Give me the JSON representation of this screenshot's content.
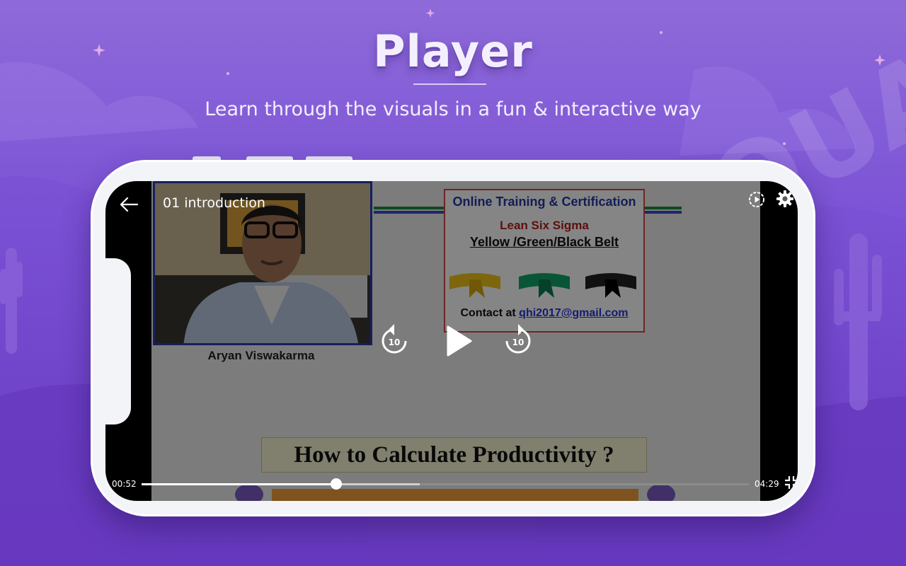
{
  "promo": {
    "headline": "Player",
    "tagline": "Learn through the visuals in a fun & interactive way",
    "watermark": "QUAL"
  },
  "player": {
    "video_title": "01 introduction",
    "time_current": "00:52",
    "time_total": "04:29",
    "progress_fraction": 0.32,
    "buffered_fraction": 0.458,
    "skip_back_label": "10",
    "skip_forward_label": "10",
    "icons": {
      "back": "arrow-left-icon",
      "cast": "play-circle-icon",
      "settings": "gear-icon",
      "rewind": "replay-10-icon",
      "play": "play-icon",
      "forward": "forward-10-icon",
      "fullscreen": "fullscreen-exit-icon"
    }
  },
  "video_frame": {
    "presenter_name": "Aryan Viswakarma",
    "card_title": "Online Training & Certification",
    "card_subtitle": "Lean Six Sigma",
    "card_belts": "Yellow /Green/Black Belt",
    "contact_prefix": "Contact at",
    "contact_email": "qhi2017@gmail.com",
    "lesson_banner": "How to Calculate Productivity ?"
  },
  "colors": {
    "background": "#7d55d6",
    "phone_frame": "#f3f4f8",
    "progress_played": "#ffffff",
    "progress_track": "#8d8d8d"
  }
}
